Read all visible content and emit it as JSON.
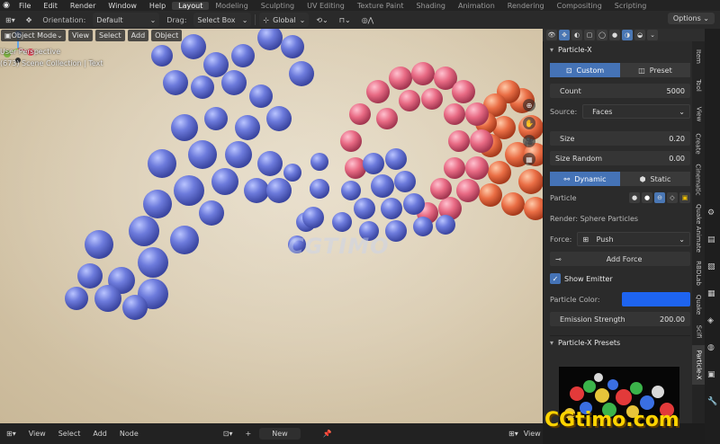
{
  "topbar": {
    "menus": [
      "File",
      "Edit",
      "Render",
      "Window",
      "Help"
    ],
    "workspaces": [
      "Layout",
      "Modeling",
      "Sculpting",
      "UV Editing",
      "Texture Paint",
      "Shading",
      "Animation",
      "Rendering",
      "Compositing",
      "Scripting"
    ],
    "active_workspace": "Layout"
  },
  "toolbar": {
    "orientation_label": "Orientation:",
    "orientation_value": "Default",
    "drag_label": "Drag:",
    "drag_value": "Select Box",
    "transform_value": "Global",
    "options_label": "Options"
  },
  "viewport_header": {
    "mode": "Object Mode",
    "menus": [
      "View",
      "Select",
      "Add",
      "Object"
    ]
  },
  "viewport": {
    "perspective": "User Perspective",
    "collection": "(673) Scene Collection | Text",
    "watermark": "CGTIMO"
  },
  "panel": {
    "title": "Particle-X",
    "custom_label": "Custom",
    "preset_label": "Preset",
    "count_label": "Count",
    "count_value": "5000",
    "source_label": "Source:",
    "source_value": "Faces",
    "size_label": "Size",
    "size_value": "0.20",
    "size_random_label": "Size Random",
    "size_random_value": "0.00",
    "dynamic_label": "Dynamic",
    "static_label": "Static",
    "particle_label": "Particle",
    "render_label": "Render: Sphere Particles",
    "force_label": "Force:",
    "force_value": "Push",
    "add_force_label": "Add Force",
    "show_emitter_label": "Show Emitter",
    "particle_color_label": "Particle Color:",
    "particle_color": "#1e64f0",
    "emission_strength_label": "Emission Strength",
    "emission_strength_value": "200.00",
    "presets_label": "Particle-X Presets"
  },
  "sidebar_tabs": [
    "Item",
    "Tool",
    "View",
    "Create",
    "Cinematic",
    "Quake Animate",
    "RBDLab",
    "Quake",
    "Scifi",
    "Particle-X"
  ],
  "active_sidebar_tab": "Particle-X",
  "bottombar": {
    "menus": [
      "View",
      "Select",
      "Add",
      "Node"
    ],
    "new_label": "New",
    "view_label": "View"
  },
  "brand_watermark": "CGtimo.com"
}
